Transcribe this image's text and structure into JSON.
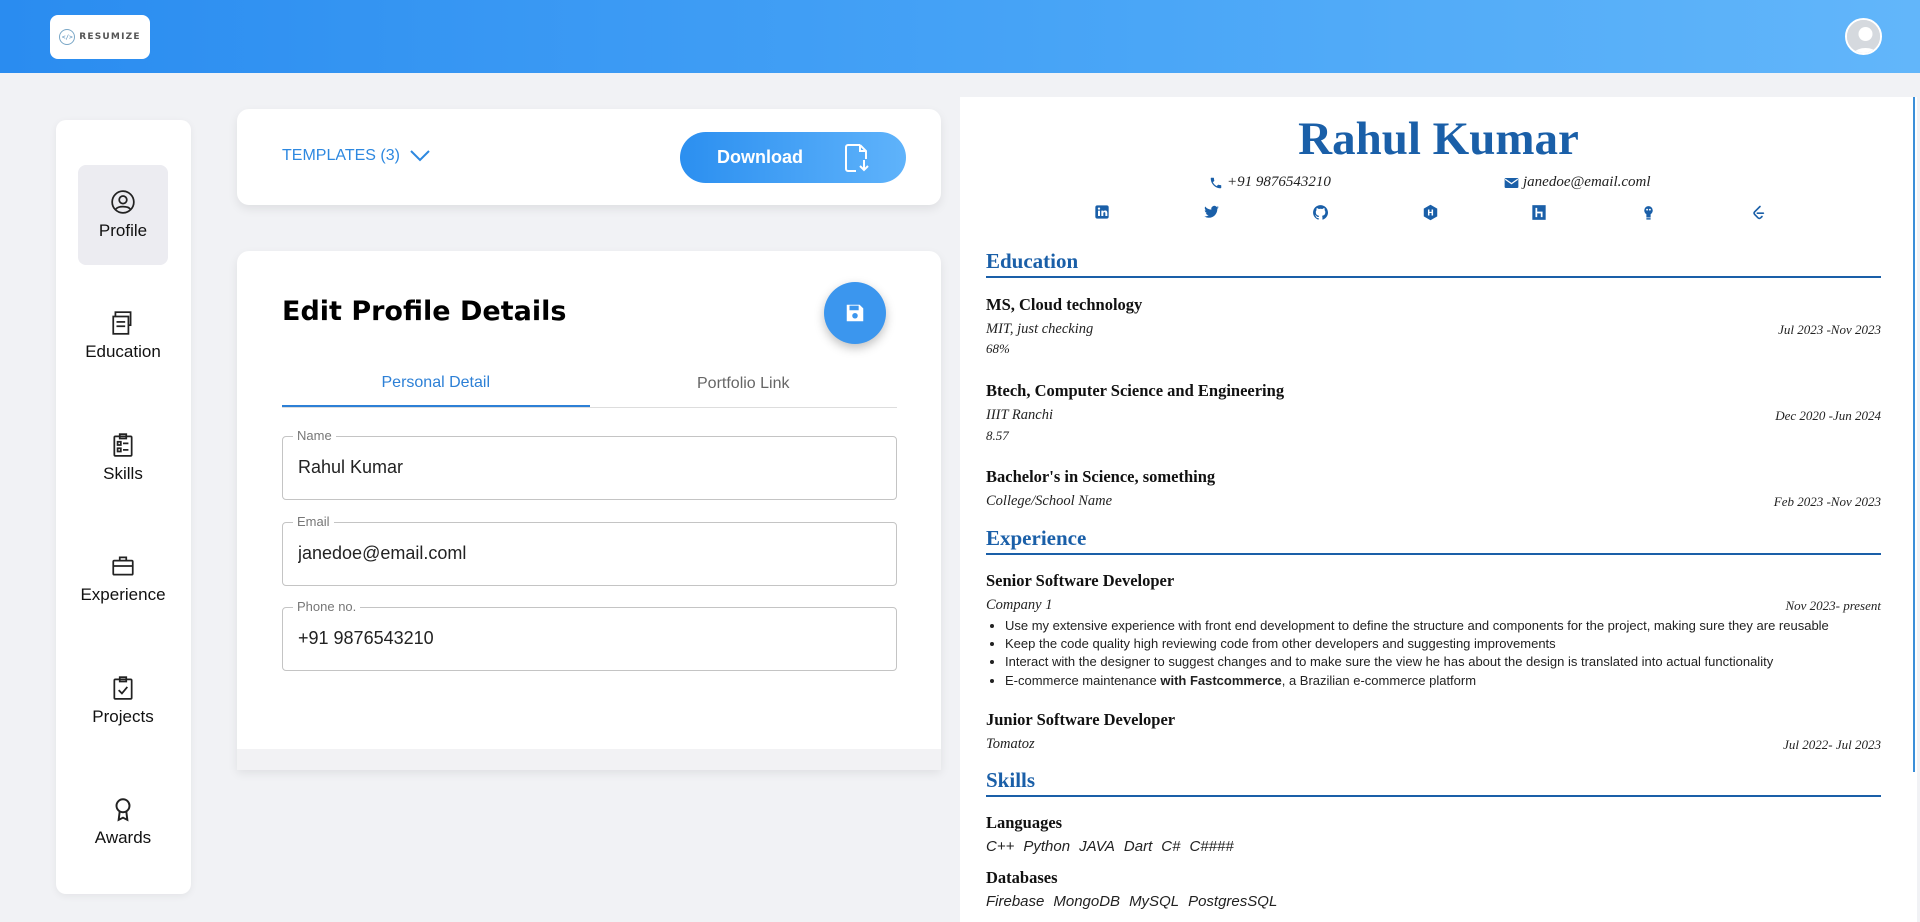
{
  "app": {
    "logo_text": "RESUMIZE"
  },
  "sidebar": {
    "items": [
      {
        "label": "Profile"
      },
      {
        "label": "Education"
      },
      {
        "label": "Skills"
      },
      {
        "label": "Experience"
      },
      {
        "label": "Projects"
      },
      {
        "label": "Awards"
      }
    ]
  },
  "templates": {
    "label": "TEMPLATES (3)",
    "download_label": "Download"
  },
  "editor": {
    "title": "Edit Profile Details",
    "tabs": [
      {
        "label": "Personal Detail"
      },
      {
        "label": "Portfolio Link"
      }
    ],
    "fields": [
      {
        "label": "Name",
        "value": "Rahul Kumar"
      },
      {
        "label": "Email",
        "value": "janedoe@email.coml"
      },
      {
        "label": "Phone no.",
        "value": "+91 9876543210"
      }
    ]
  },
  "resume": {
    "name": "Rahul Kumar",
    "phone": "+91 9876543210",
    "email": "janedoe@email.coml",
    "sections": {
      "education": "Education",
      "experience": "Experience",
      "skills": "Skills"
    },
    "education": [
      {
        "degree": "MS, Cloud technology",
        "school": "MIT, just checking",
        "dates": "Jul 2023 -Nov 2023",
        "score": "68%"
      },
      {
        "degree": "Btech, Computer Science and Engineering",
        "school": "IIIT Ranchi",
        "dates": "Dec 2020 -Jun 2024",
        "score": "8.57"
      },
      {
        "degree": "Bachelor's in Science, something",
        "school": "College/School Name",
        "dates": "Feb 2023 -Nov 2023"
      }
    ],
    "experience": [
      {
        "title": "Senior Software Developer",
        "company": "Company 1",
        "dates": "Nov 2023- present",
        "bullets": [
          "Use my extensive experience with front end development to define the structure and components for the project, making sure they are reusable",
          "Keep the code quality high reviewing code from other developers and suggesting improvements",
          "Interact with the designer to suggest changes and to make sure the view he has about the design is translated into actual functionality"
        ],
        "last_bullet_pre": "E-commerce maintenance ",
        "last_bullet_bold": "with Fastcommerce",
        "last_bullet_post": ", a Brazilian e-commerce platform"
      },
      {
        "title": "Junior Software Developer",
        "company": "Tomatoz",
        "dates": "Jul 2022- Jul 2023"
      }
    ],
    "skills": [
      {
        "category": "Languages",
        "items": [
          "C++",
          "Python",
          "JAVA",
          "Dart",
          "C#",
          "C####"
        ]
      },
      {
        "category": "Databases",
        "items": [
          "Firebase",
          "MongoDB",
          "MySQL",
          "PostgresSQL"
        ]
      }
    ],
    "social_icons": [
      "linkedin-icon",
      "twitter-icon",
      "github-icon",
      "hashnode-icon",
      "hackerrank-icon",
      "codechef-icon",
      "leetcode-icon"
    ]
  },
  "colors": {
    "primary": "#2d88e0",
    "resume_accent": "#1a5fa8",
    "topbar_start": "#2a8cf0",
    "topbar_end": "#62b6fa"
  }
}
